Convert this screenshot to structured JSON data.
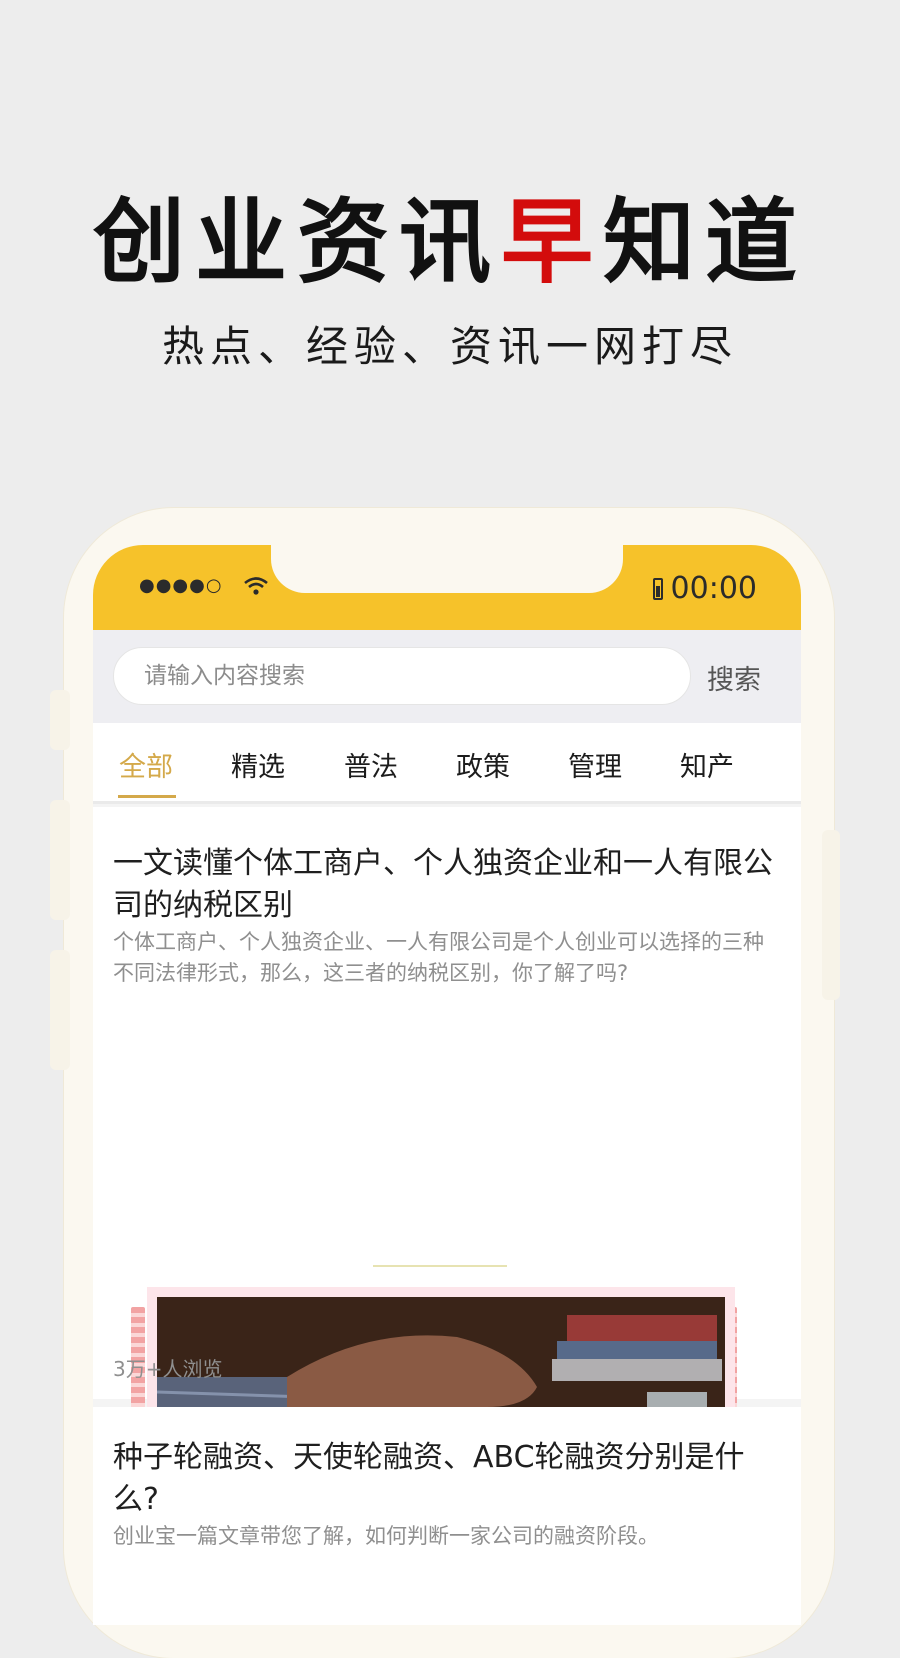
{
  "promo": {
    "headline_part1": "创业资讯",
    "headline_accent": "早",
    "headline_part2": "知道",
    "subheadline": "热点、经验、资讯一网打尽"
  },
  "status_bar": {
    "time": "00:00",
    "signal": "●●●●○"
  },
  "search": {
    "placeholder": "请输入内容搜索",
    "button_label": "搜索"
  },
  "tabs": [
    {
      "label": "全部",
      "active": true
    },
    {
      "label": "精选"
    },
    {
      "label": "普法"
    },
    {
      "label": "政策"
    },
    {
      "label": "管理"
    },
    {
      "label": "知产"
    }
  ],
  "articles": [
    {
      "title": "一文读懂个体工商户、个人独资企业和一人有限公司的纳税区别",
      "summary": "个体工商户、个人独资企业、一人有限公司是个人创业可以选择的三种不同法律形式，那么，这三者的纳税区别，你了解了吗?",
      "views": "3万+人浏览"
    },
    {
      "title": "种子轮融资、天使轮融资、ABC轮融资分别是什么?",
      "summary": "创业宝一篇文章带您了解，如何判断一家公司的融资阶段。"
    }
  ],
  "colors": {
    "brand_yellow": "#f6c22a",
    "accent_red": "#d30c0c",
    "tab_active": "#d4a94a"
  }
}
